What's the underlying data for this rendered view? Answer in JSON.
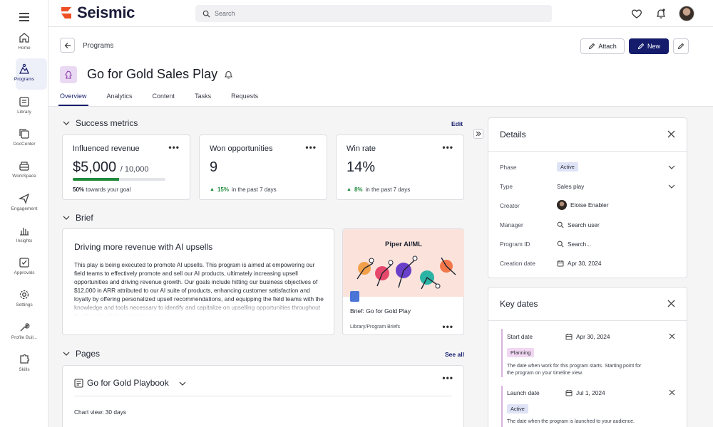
{
  "app": {
    "name": "Seismic"
  },
  "search": {
    "placeholder": "Search"
  },
  "nav": {
    "items": [
      {
        "label": "Home",
        "icon": "home-icon"
      },
      {
        "label": "Programs",
        "icon": "programs-icon",
        "active": true
      },
      {
        "label": "Library",
        "icon": "library-icon"
      },
      {
        "label": "DocCenter",
        "icon": "doccenter-icon"
      },
      {
        "label": "WorkSpace",
        "icon": "workspace-icon"
      },
      {
        "label": "Engagement",
        "icon": "engagement-icon"
      },
      {
        "label": "Insights",
        "icon": "insights-icon"
      },
      {
        "label": "Approvals",
        "icon": "approvals-icon"
      },
      {
        "label": "Settings",
        "icon": "settings-icon"
      },
      {
        "label": "Profile Buil...",
        "icon": "profile-builder-icon"
      },
      {
        "label": "Skills",
        "icon": "skills-icon"
      }
    ]
  },
  "header": {
    "breadcrumb": "Programs",
    "title": "Go for Gold Sales Play",
    "attach_label": "Attach",
    "new_label": "New",
    "tabs": [
      {
        "label": "Overview",
        "active": true
      },
      {
        "label": "Analytics"
      },
      {
        "label": "Content"
      },
      {
        "label": "Tasks"
      },
      {
        "label": "Requests"
      }
    ]
  },
  "success_metrics": {
    "heading": "Success metrics",
    "edit_label": "Edit",
    "cards": [
      {
        "title": "Influenced revenue",
        "value": "$5,000",
        "target": "/ 10,000",
        "progress": 0.5,
        "foot_strong": "50%",
        "foot_text": "towards your goal"
      },
      {
        "title": "Won opportunities",
        "value": "9",
        "change": "15%",
        "change_text": "in the past 7 days"
      },
      {
        "title": "Win rate",
        "value": "14%",
        "change": "8%",
        "change_text": "in the past 7 days"
      }
    ]
  },
  "brief": {
    "heading": "Brief",
    "title": "Driving more revenue with AI upsells",
    "body": "This play is being executed to promote AI upsells. This program is aimed at empowering our field teams to effectively promote and sell our AI products, ultimately increasing upsell opportunities and driving revenue growth. Our goals include hitting our business objectives of $12,000 in ARR attributed to our AI suite of products, enhancing customer satisfaction and loyalty by offering personalized upsell recommendations, and equipping the field teams with the knowledge and tools necessary to identify and capitalize on upselling opportunities throughout the lifecycle of the customer journey.",
    "attachment": {
      "thumb_title": "Piper AI/ML",
      "name": "Brief: Go for Gold Play",
      "path": "Library/Program Briefs"
    }
  },
  "pages": {
    "heading": "Pages",
    "see_all_label": "See all",
    "playbook_title": "Go for Gold Playbook",
    "chart_view": "Chart view: 30 days"
  },
  "details": {
    "title": "Details",
    "rows": [
      {
        "label": "Phase",
        "value": "Active"
      },
      {
        "label": "Type",
        "value": "Sales play"
      },
      {
        "label": "Creator",
        "value": "Eloise Enabler"
      },
      {
        "label": "Manager",
        "value": "Search user"
      },
      {
        "label": "Program ID",
        "value": "Search..."
      },
      {
        "label": "Creation date",
        "value": "Apr 30, 2024"
      }
    ]
  },
  "key_dates": {
    "title": "Key dates",
    "items": [
      {
        "label": "Start date",
        "date": "Apr 30, 2024",
        "status": "Planning",
        "desc": "The date when work for this program starts. Starting point for the program on your timeline view."
      },
      {
        "label": "Launch date",
        "date": "Jul 1, 2024",
        "status": "Active",
        "desc": "The date when the program is launched to your audience."
      }
    ]
  },
  "colors": {
    "brand_navy": "#141c6b",
    "brand_orange": "#f04e23",
    "success_green": "#1f8a3b",
    "planning_pill": "#f1d7f2",
    "active_pill": "#dfe3f6"
  }
}
